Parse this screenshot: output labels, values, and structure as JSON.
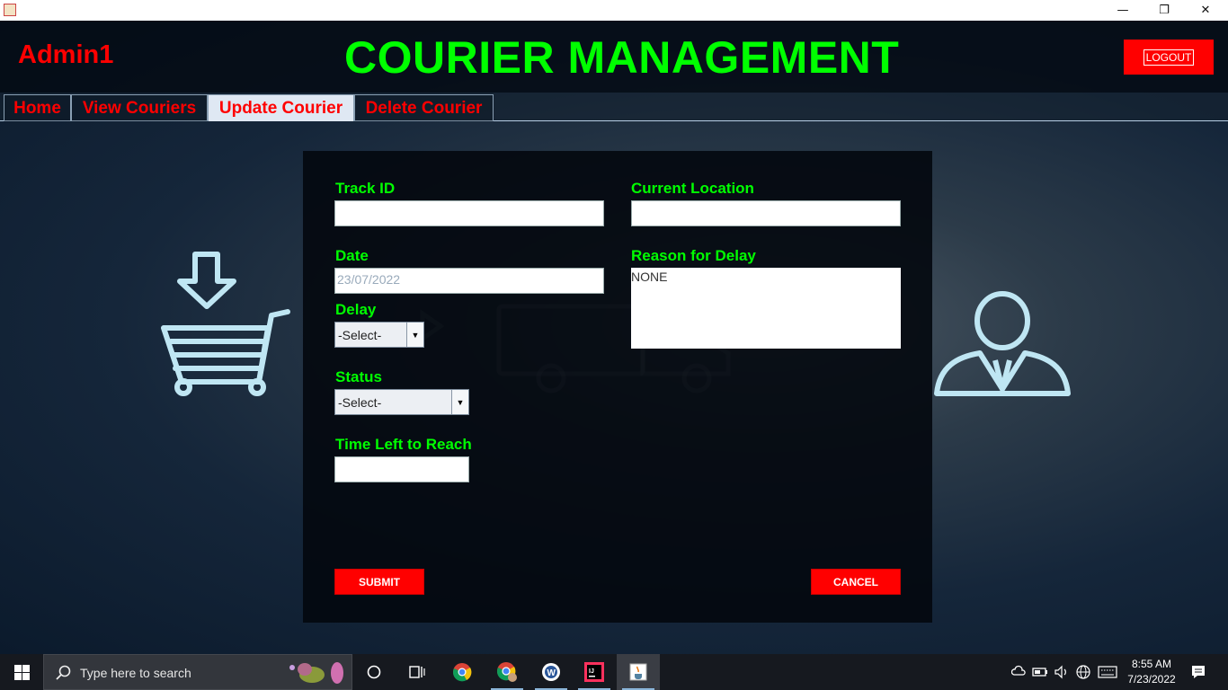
{
  "window": {
    "minimize_glyph": "—",
    "restore_glyph": "❐",
    "close_glyph": "✕"
  },
  "header": {
    "user": "Admin1",
    "title": "COURIER MANAGEMENT",
    "logout_label": "LOGOUT"
  },
  "tabs": [
    {
      "label": "Home"
    },
    {
      "label": "View Couriers"
    },
    {
      "label": "Update Courier",
      "active": true
    },
    {
      "label": "Delete Courier"
    }
  ],
  "form": {
    "track_id": {
      "label": "Track ID",
      "value": ""
    },
    "current_location": {
      "label": "Current Location",
      "value": ""
    },
    "date": {
      "label": "Date",
      "value": "23/07/2022"
    },
    "reason": {
      "label": "Reason for Delay",
      "value": "NONE"
    },
    "delay": {
      "label": "Delay",
      "selected": "-Select-"
    },
    "status": {
      "label": "Status",
      "selected": "-Select-"
    },
    "time_left": {
      "label": "Time Left to Reach",
      "value": ""
    },
    "submit_label": "SUBMIT",
    "cancel_label": "CANCEL"
  },
  "taskbar": {
    "search_placeholder": "Type here to search",
    "time": "8:55 AM",
    "date": "7/23/2022",
    "apps": [
      "cortana-icon",
      "task-view-icon",
      "chrome-icon",
      "chrome-profile-icon",
      "word-icon",
      "intellij-icon",
      "java-icon"
    ]
  },
  "colors": {
    "accent_green": "#00ff00",
    "accent_red": "#ff0000"
  }
}
